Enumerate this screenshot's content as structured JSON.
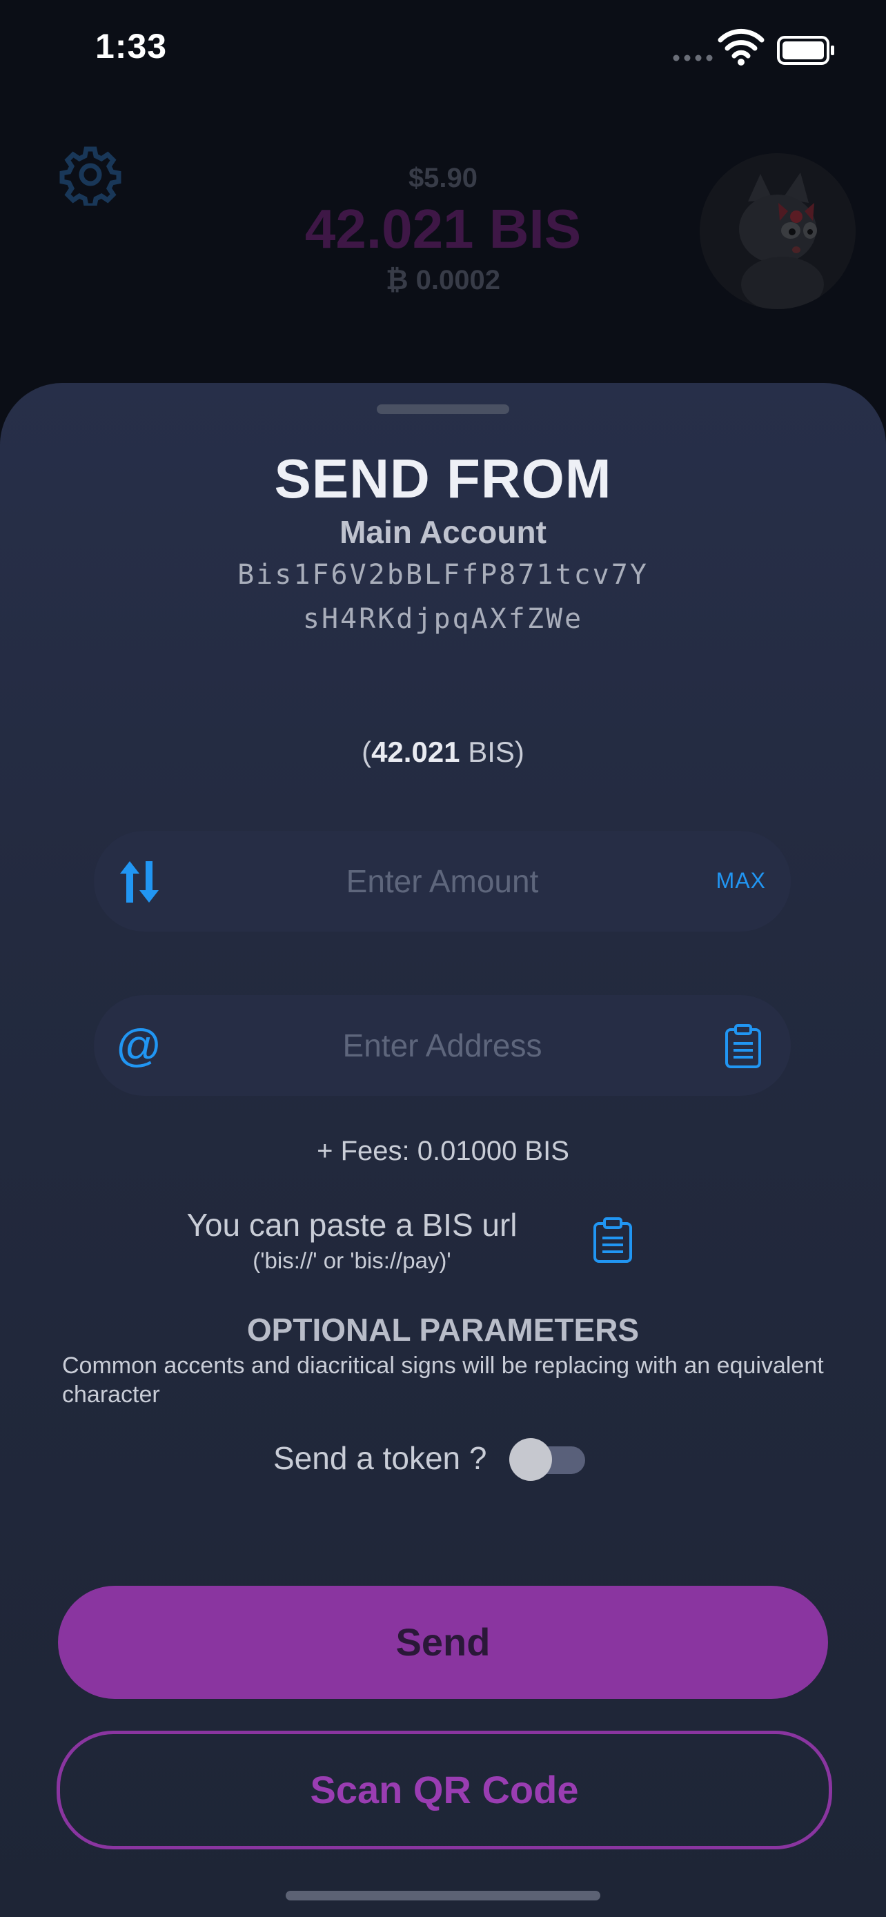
{
  "status_bar": {
    "time": "1:33"
  },
  "header": {
    "fiat_balance": "$5.90",
    "bis_balance": "42.021 BIS",
    "btc_balance": "₿ 0.0002"
  },
  "sheet": {
    "title": "SEND FROM",
    "account_name": "Main Account",
    "address_line1": "Bis1F6V2bBLFfP871tcv7Y",
    "address_line2": "sH4RKdjpqAXfZWe",
    "available_amount": "42.021",
    "available_unit": "BIS",
    "amount_input": {
      "placeholder": "Enter Amount",
      "value": ""
    },
    "max_label": "MAX",
    "address_input": {
      "placeholder": "Enter Address",
      "value": ""
    },
    "at_symbol": "@",
    "fees": "+ Fees: 0.01000 BIS",
    "paste_url_text": "You can paste a BIS url",
    "paste_url_hint": "('bis://' or 'bis://pay)'",
    "optional_title": "OPTIONAL PARAMETERS",
    "optional_desc": "Common accents and diacritical signs will be replacing with an equivalent character",
    "token_label": "Send a token ?",
    "token_toggle_on": false
  },
  "buttons": {
    "send": "Send",
    "scan": "Scan QR Code"
  },
  "colors": {
    "accent_blue": "#2196f3",
    "accent_purple": "#8a35a0",
    "sheet_bg": "#262d45"
  },
  "icons": [
    "settings-gear-icon",
    "switch-arrows-icon",
    "at-sign-icon",
    "clipboard-icon",
    "wifi-icon",
    "battery-icon",
    "signal-icon"
  ]
}
